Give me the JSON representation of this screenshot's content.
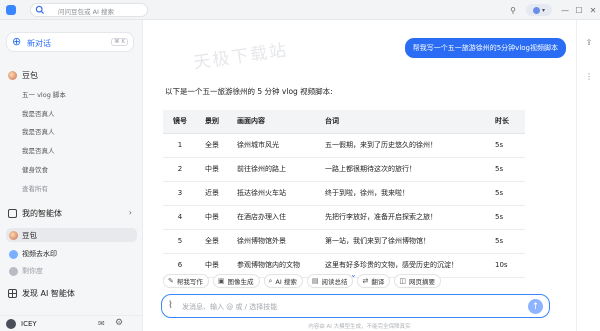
{
  "topbar": {
    "search_placeholder": "问问豆包或 AI 搜索"
  },
  "sidebar": {
    "new_chat_label": "新对话",
    "new_chat_shortcut": "⌘ K",
    "doubao_label": "豆包",
    "history": [
      "五一 vlog 脚本",
      "我是否真人",
      "我是否真人",
      "我是否真人",
      "健身饮食"
    ],
    "view_all": "查看所有",
    "my_agents_label": "我的智能体",
    "agents": [
      "豆包",
      "视频去水印",
      "剩你度"
    ],
    "discover_label": "发现 AI 智能体",
    "user_name": "ICEY"
  },
  "chat": {
    "watermark": "天极下载站",
    "user_message": "帮我写一个五一旅游徐州的5分钟vlog视频脚本",
    "intro": "以下是一个五一旅游徐州的 5 分钟 vlog 视频脚本:",
    "table": {
      "headers": [
        "镜号",
        "景别",
        "画面内容",
        "台词",
        "时长"
      ],
      "rows": [
        [
          "1",
          "全景",
          "徐州城市风光",
          "五一假期，来到了历史悠久的徐州！",
          "5s"
        ],
        [
          "2",
          "中景",
          "前往徐州的路上",
          "一路上都很期待这次的旅行！",
          "5s"
        ],
        [
          "3",
          "近景",
          "抵达徐州火车站",
          "终于到啦，徐州，我来啦！",
          "5s"
        ],
        [
          "4",
          "中景",
          "在酒店办理入住",
          "先把行李放好，准备开启探索之旅！",
          "5s"
        ],
        [
          "5",
          "全景",
          "徐州博物馆外景",
          "第一站，我们来到了徐州博物馆！",
          "5s"
        ],
        [
          "6",
          "中景",
          "参观博物馆内的文物",
          "这里有好多珍贵的文物，感受历史的沉淀！",
          "10s"
        ]
      ]
    }
  },
  "tools": [
    "帮我写作",
    "图像生成",
    "AI 搜索",
    "阅读总结",
    "翻译",
    "网页摘要"
  ],
  "input": {
    "placeholder": "发消息、输入 @ 或 / 选择技能"
  },
  "footer": "内容由 AI 大模型生成，不能完全保障真实"
}
